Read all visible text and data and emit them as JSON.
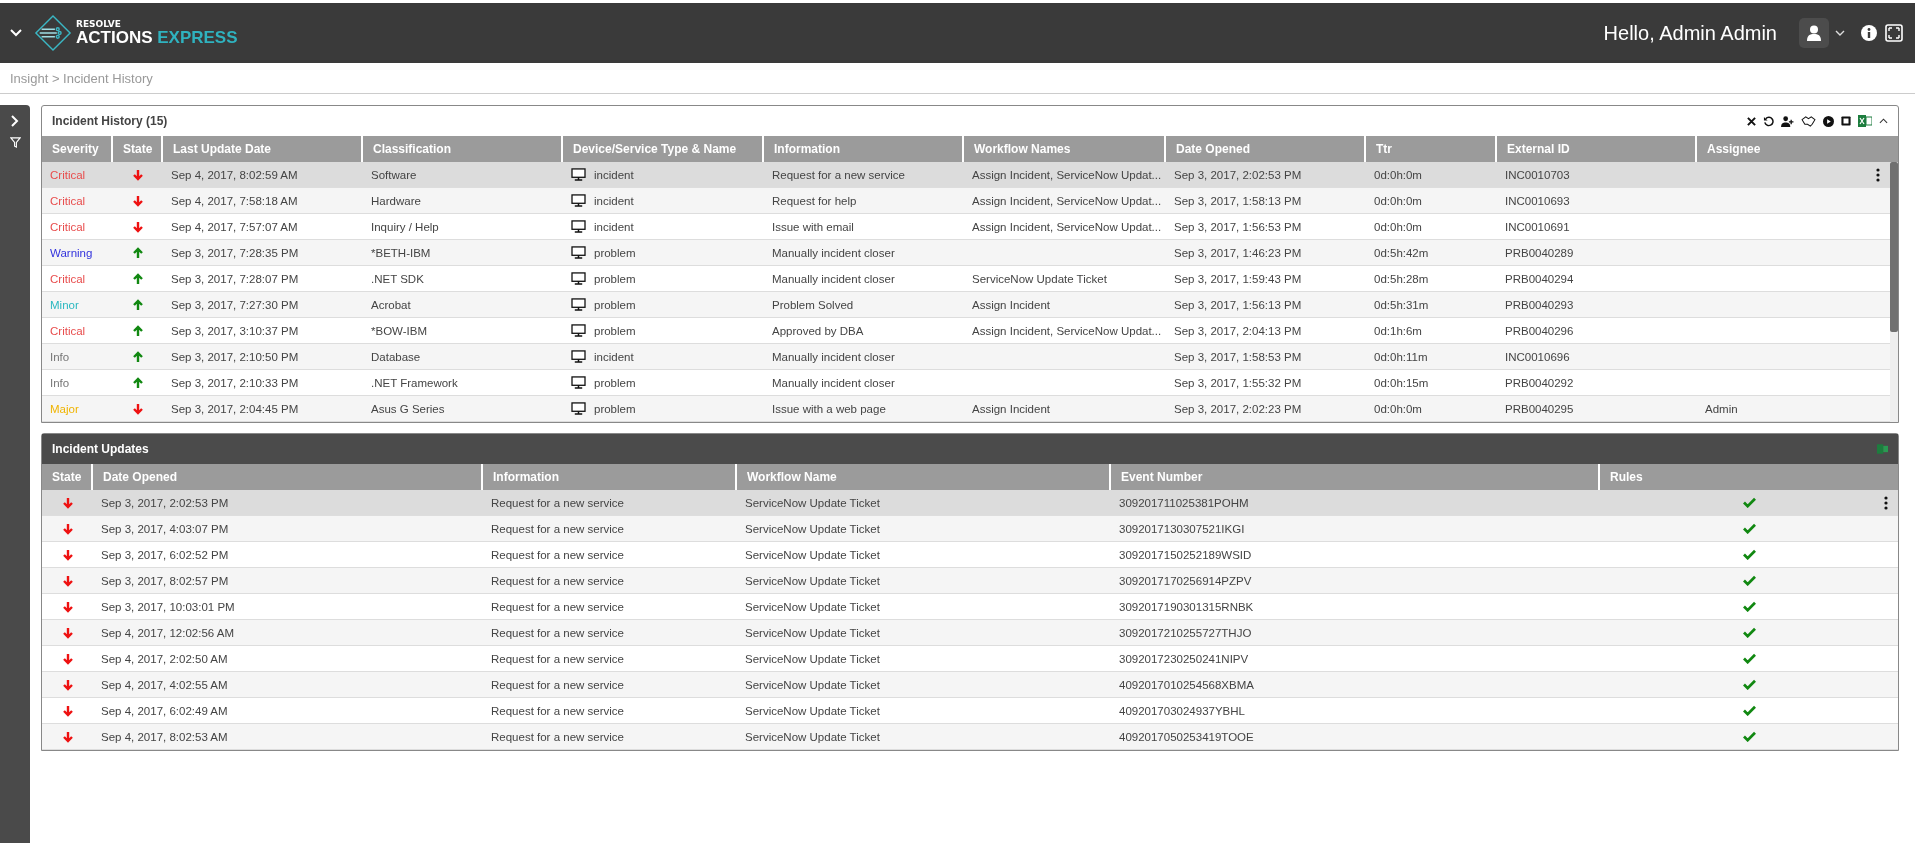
{
  "header": {
    "logo_top": "RESOLVE",
    "logo_main": "ACTIONS",
    "logo_accent": "EXPRESS",
    "greeting": "Hello, Admin Admin"
  },
  "breadcrumb": "Insight > Incident History",
  "incident_history": {
    "title": "Incident History (15)",
    "columns": [
      "Severity",
      "State",
      "Last Update Date",
      "Classification",
      "Device/Service Type & Name",
      "Information",
      "Workflow Names",
      "Date Opened",
      "Ttr",
      "External ID",
      "Assignee"
    ],
    "rows": [
      {
        "selected": true,
        "severity": "Critical",
        "color": "#e84c4c",
        "kind": "down",
        "last_update": "Sep 4, 2017, 8:02:59 AM",
        "classification": "Software",
        "device": "incident",
        "information": "Request for a new service",
        "workflow": "Assign Incident, ServiceNow Updat...",
        "date_opened": "Sep 3, 2017, 2:02:53 PM",
        "ttr": "0d:0h:0m",
        "external_id": "INC0010703"
      },
      {
        "selected": false,
        "severity": "Critical",
        "color": "#e84c4c",
        "kind": "down",
        "last_update": "Sep 4, 2017, 7:58:18 AM",
        "classification": "Hardware",
        "device": "incident",
        "information": "Request for help",
        "workflow": "Assign Incident, ServiceNow Updat...",
        "date_opened": "Sep 3, 2017, 1:58:13 PM",
        "ttr": "0d:0h:0m",
        "external_id": "INC0010693"
      },
      {
        "selected": false,
        "severity": "Critical",
        "color": "#e84c4c",
        "kind": "down",
        "last_update": "Sep 4, 2017, 7:57:07 AM",
        "classification": "Inquiry / Help",
        "device": "incident",
        "information": "Issue with email",
        "workflow": "Assign Incident, ServiceNow Updat...",
        "date_opened": "Sep 3, 2017, 1:56:53 PM",
        "ttr": "0d:0h:0m",
        "external_id": "INC0010691"
      },
      {
        "selected": false,
        "severity": "Warning",
        "color": "#3333dd",
        "kind": "up",
        "last_update": "Sep 3, 2017, 7:28:35 PM",
        "classification": "*BETH-IBM",
        "device": "problem",
        "information": "Manually incident closer",
        "date_opened": "Sep 3, 2017, 1:46:23 PM",
        "ttr": "0d:5h:42m",
        "external_id": "PRB0040289"
      },
      {
        "selected": false,
        "severity": "Critical",
        "color": "#e84c4c",
        "kind": "up",
        "last_update": "Sep 3, 2017, 7:28:07 PM",
        "classification": ".NET SDK",
        "device": "problem",
        "information": "Manually incident closer",
        "workflow": "ServiceNow Update Ticket",
        "date_opened": "Sep 3, 2017, 1:59:43 PM",
        "ttr": "0d:5h:28m",
        "external_id": "PRB0040294"
      },
      {
        "selected": false,
        "severity": "Minor",
        "color": "#2bb8c0",
        "kind": "up",
        "last_update": "Sep 3, 2017, 7:27:30 PM",
        "classification": "Acrobat",
        "device": "problem",
        "information": "Problem Solved",
        "workflow": "Assign Incident",
        "date_opened": "Sep 3, 2017, 1:56:13 PM",
        "ttr": "0d:5h:31m",
        "external_id": "PRB0040293"
      },
      {
        "selected": false,
        "severity": "Critical",
        "color": "#e84c4c",
        "kind": "up",
        "last_update": "Sep 3, 2017, 3:10:37 PM",
        "classification": "*BOW-IBM",
        "device": "problem",
        "information": "Approved by DBA",
        "workflow": "Assign Incident, ServiceNow Updat...",
        "date_opened": "Sep 3, 2017, 2:04:13 PM",
        "ttr": "0d:1h:6m",
        "external_id": "PRB0040296"
      },
      {
        "selected": false,
        "severity": "Info",
        "color": "#777777",
        "kind": "up",
        "last_update": "Sep 3, 2017, 2:10:50 PM",
        "classification": "Database",
        "device": "incident",
        "information": "Manually incident closer",
        "date_opened": "Sep 3, 2017, 1:58:53 PM",
        "ttr": "0d:0h:11m",
        "external_id": "INC0010696"
      },
      {
        "selected": false,
        "severity": "Info",
        "color": "#777777",
        "kind": "up",
        "last_update": "Sep 3, 2017, 2:10:33 PM",
        "classification": ".NET Framework",
        "device": "problem",
        "information": "Manually incident closer",
        "date_opened": "Sep 3, 2017, 1:55:32 PM",
        "ttr": "0d:0h:15m",
        "external_id": "PRB0040292"
      },
      {
        "selected": false,
        "severity": "Major",
        "color": "#f0b400",
        "kind": "down",
        "last_update": "Sep 3, 2017, 2:04:45 PM",
        "classification": "Asus G Series",
        "device": "problem",
        "information": "Issue with a web page",
        "workflow": "Assign Incident",
        "date_opened": "Sep 3, 2017, 2:02:23 PM",
        "ttr": "0d:0h:0m",
        "external_id": "PRB0040295",
        "assignee": "Admin"
      }
    ]
  },
  "incident_updates": {
    "title": "Incident Updates",
    "columns": [
      "State",
      "Date Opened",
      "Information",
      "Workflow Name",
      "Event Number",
      "Rules"
    ],
    "rows": [
      {
        "selected": true,
        "kind": "down",
        "date_opened": "Sep 3, 2017, 2:02:53 PM",
        "information": "Request for a new service",
        "workflow": "ServiceNow Update Ticket",
        "event_number": "309201711025381POHM",
        "passed": true
      },
      {
        "selected": false,
        "kind": "down",
        "date_opened": "Sep 3, 2017, 4:03:07 PM",
        "information": "Request for a new service",
        "workflow": "ServiceNow Update Ticket",
        "event_number": "3092017130307521IKGI",
        "passed": true
      },
      {
        "selected": false,
        "kind": "down",
        "date_opened": "Sep 3, 2017, 6:02:52 PM",
        "information": "Request for a new service",
        "workflow": "ServiceNow Update Ticket",
        "event_number": "3092017150252189WSID",
        "passed": true
      },
      {
        "selected": false,
        "kind": "down",
        "date_opened": "Sep 3, 2017, 8:02:57 PM",
        "information": "Request for a new service",
        "workflow": "ServiceNow Update Ticket",
        "event_number": "3092017170256914PZPV",
        "passed": true
      },
      {
        "selected": false,
        "kind": "down",
        "date_opened": "Sep 3, 2017, 10:03:01 PM",
        "information": "Request for a new service",
        "workflow": "ServiceNow Update Ticket",
        "event_number": "3092017190301315RNBK",
        "passed": true
      },
      {
        "selected": false,
        "kind": "down",
        "date_opened": "Sep 4, 2017, 12:02:56 AM",
        "information": "Request for a new service",
        "workflow": "ServiceNow Update Ticket",
        "event_number": "3092017210255727THJO",
        "passed": true
      },
      {
        "selected": false,
        "kind": "down",
        "date_opened": "Sep 4, 2017, 2:02:50 AM",
        "information": "Request for a new service",
        "workflow": "ServiceNow Update Ticket",
        "event_number": "3092017230250241NIPV",
        "passed": true
      },
      {
        "selected": false,
        "kind": "down",
        "date_opened": "Sep 4, 2017, 4:02:55 AM",
        "information": "Request for a new service",
        "workflow": "ServiceNow Update Ticket",
        "event_number": "4092017010254568XBMA",
        "passed": true
      },
      {
        "selected": false,
        "kind": "down",
        "date_opened": "Sep 4, 2017, 6:02:49 AM",
        "information": "Request for a new service",
        "workflow": "ServiceNow Update Ticket",
        "event_number": "409201703024937YBHL",
        "passed": true
      },
      {
        "selected": false,
        "kind": "down",
        "date_opened": "Sep 4, 2017, 8:02:53 AM",
        "information": "Request for a new service",
        "workflow": "ServiceNow Update Ticket",
        "event_number": "4092017050253419TOOE",
        "passed": true
      }
    ]
  }
}
